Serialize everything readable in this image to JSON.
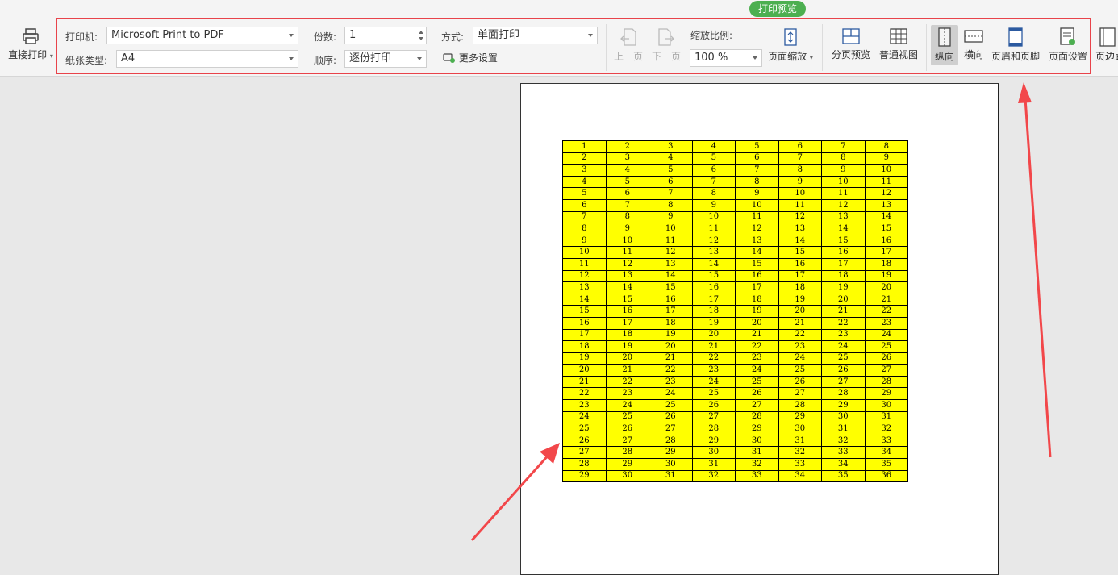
{
  "tab_badge": "打印预览",
  "direct_print": {
    "label": "直接打印"
  },
  "printer": {
    "label": "打印机:",
    "value": "Microsoft Print to PDF"
  },
  "paper": {
    "label": "纸张类型:",
    "value": "A4"
  },
  "copies": {
    "label": "份数:",
    "value": "1"
  },
  "order": {
    "label": "顺序:",
    "value": "逐份打印"
  },
  "mode": {
    "label": "方式:",
    "value": "单面打印"
  },
  "more_settings": {
    "label": "更多设置"
  },
  "prev_page": {
    "label": "上一页"
  },
  "next_page": {
    "label": "下一页"
  },
  "zoom": {
    "label": "缩放比例:",
    "value": "100 %"
  },
  "page_scale": {
    "label": "页面缩放"
  },
  "page_break_preview": {
    "label": "分页预览"
  },
  "normal_view": {
    "label": "普通视图"
  },
  "portrait": {
    "label": "纵向"
  },
  "landscape": {
    "label": "横向"
  },
  "header_footer": {
    "label": "页眉和页脚"
  },
  "page_setup": {
    "label": "页面设置"
  },
  "margins": {
    "label": "页边距"
  },
  "accent_colors": {
    "badge": "#4caf50",
    "highlight": "#e8434a",
    "cell_fill": "#ffff00"
  },
  "table": {
    "rows": 29,
    "cols": 8,
    "first_cell": 1,
    "last_cell": 36,
    "rule": "cell value = row number + column number - 1"
  }
}
